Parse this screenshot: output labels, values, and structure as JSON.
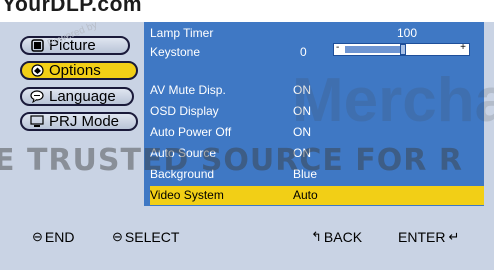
{
  "watermark": {
    "brand": "YourDLP.com",
    "store": "Powered by ",
    "merchant": "Merchant",
    "trusted": "E TRUSTED SOURCE FOR R"
  },
  "sidebar": {
    "items": [
      {
        "label": "Picture",
        "icon": "picture-icon",
        "active": false
      },
      {
        "label": "Options",
        "icon": "options-icon",
        "active": true
      },
      {
        "label": "Language",
        "icon": "language-icon",
        "active": false
      },
      {
        "label": "PRJ Mode",
        "icon": "prj-mode-icon",
        "active": false
      }
    ]
  },
  "settings": {
    "rows": [
      {
        "label": "Lamp Timer",
        "value": "100"
      },
      {
        "label": "Keystone",
        "value": "0"
      },
      {
        "label": "AV Mute Disp.",
        "value": "ON"
      },
      {
        "label": "OSD Display",
        "value": "ON"
      },
      {
        "label": "Auto Power Off",
        "value": "ON"
      },
      {
        "label": "Auto Source",
        "value": "ON"
      },
      {
        "label": "Background",
        "value": "Blue"
      },
      {
        "label": "Video System",
        "value": "Auto"
      }
    ],
    "selected_index": 7,
    "keystone_slider": {
      "minus": "-",
      "plus": "+",
      "level": 0.48
    }
  },
  "footer": {
    "end": "END",
    "select": "SELECT",
    "back": "BACK",
    "enter": "ENTER"
  },
  "colors": {
    "panel_bg": "#3f78c4",
    "highlight": "#f2cf16",
    "screen_bg": "#c9d3e4"
  }
}
